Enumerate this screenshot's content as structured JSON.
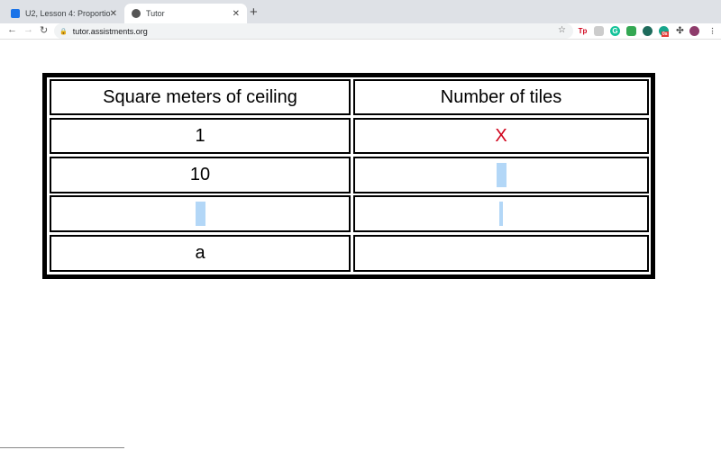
{
  "browser": {
    "tabs": [
      {
        "title": "U2, Lesson 4: Proportional Rel",
        "active": false
      },
      {
        "title": "Tutor",
        "active": true
      }
    ],
    "url": "tutor.assistments.org",
    "extensions": [
      "tp-icon",
      "extension-gray-icon",
      "grammarly-icon",
      "sheets-icon",
      "location-pin-icon",
      "extension-badge-icon",
      "puzzle-icon",
      "profile-avatar"
    ],
    "extension_badge": "0s"
  },
  "table": {
    "headers": [
      "Square meters of ceiling",
      "Number of tiles"
    ],
    "rows": [
      [
        "1",
        "X"
      ],
      [
        "10",
        ""
      ],
      [
        "",
        ""
      ],
      [
        "a",
        ""
      ]
    ]
  },
  "colors": {
    "x_mark": "#d0021b",
    "selection": "#b3d7f7"
  }
}
